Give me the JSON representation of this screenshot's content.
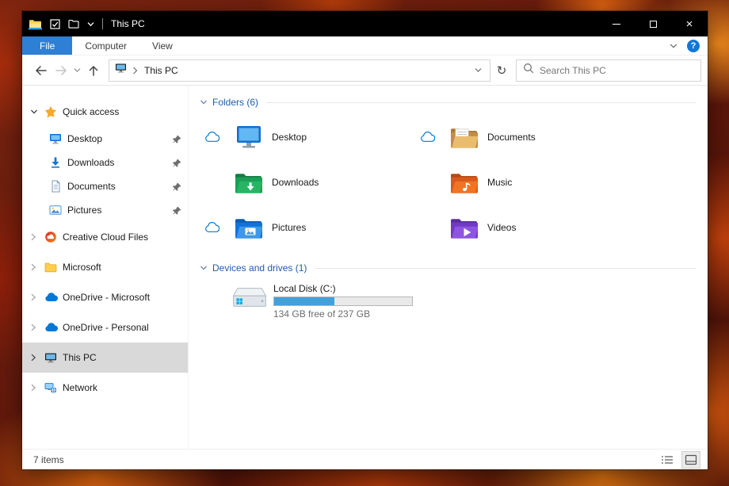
{
  "window": {
    "title": "This PC"
  },
  "ribbon": {
    "tabs": [
      {
        "label": "File"
      },
      {
        "label": "Computer"
      },
      {
        "label": "View"
      }
    ],
    "help_glyph": "?"
  },
  "navbar": {
    "address": {
      "location": "This PC"
    },
    "search_placeholder": "Search This PC"
  },
  "sidebar": {
    "items": [
      {
        "label": "Quick access",
        "expanded": true
      },
      {
        "label": "Desktop",
        "pinned": true
      },
      {
        "label": "Downloads",
        "pinned": true
      },
      {
        "label": "Documents",
        "pinned": true
      },
      {
        "label": "Pictures",
        "pinned": true
      },
      {
        "label": "Creative Cloud Files"
      },
      {
        "label": "Microsoft"
      },
      {
        "label": "OneDrive - Microsoft"
      },
      {
        "label": "OneDrive - Personal"
      },
      {
        "label": "This PC",
        "selected": true
      },
      {
        "label": "Network"
      }
    ]
  },
  "main": {
    "folders": {
      "title": "Folders (6)",
      "items": [
        {
          "label": "Desktop",
          "synced": true
        },
        {
          "label": "Documents",
          "synced": true
        },
        {
          "label": "Downloads",
          "synced": false
        },
        {
          "label": "Music",
          "synced": false
        },
        {
          "label": "Pictures",
          "synced": true
        },
        {
          "label": "Videos",
          "synced": false
        }
      ]
    },
    "devices": {
      "title": "Devices and drives (1)",
      "items": [
        {
          "label": "Local Disk (C:)",
          "free_text": "134 GB free of 237 GB",
          "used_percent": 43.5
        }
      ]
    }
  },
  "statusbar": {
    "items_count": "7 items"
  },
  "colors": {
    "accent_blue": "#0f77d7",
    "file_tab_blue": "#2e80d4",
    "group_header_blue": "#1f5da8",
    "disk_bar_fill": "#42a1d9",
    "onedrive_blue": "#0078d4"
  }
}
